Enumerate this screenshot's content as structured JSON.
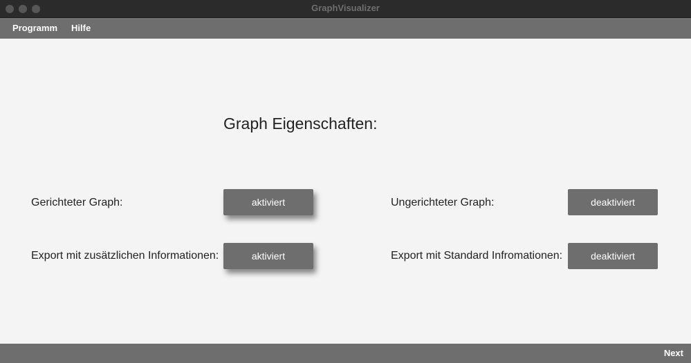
{
  "window": {
    "title": "GraphVisualizer"
  },
  "menubar": {
    "items": [
      {
        "label": "Programm"
      },
      {
        "label": "Hilfe"
      }
    ]
  },
  "main": {
    "heading": "Graph Eigenschaften:",
    "options": {
      "directed": {
        "label": "Gerichteter Graph:",
        "button": "aktiviert",
        "state": "active"
      },
      "undirected": {
        "label": "Ungerichteter Graph:",
        "button": "deaktiviert",
        "state": "inactive"
      },
      "export_extra": {
        "label": "Export mit zusätzlichen Informationen:",
        "button": "aktiviert",
        "state": "active"
      },
      "export_standard": {
        "label": "Export mit Standard Infromationen:",
        "button": "deaktiviert",
        "state": "inactive"
      }
    }
  },
  "footer": {
    "next_label": "Next"
  },
  "colors": {
    "titlebar": "#2b2b2b",
    "menubar": "#6e6e6e",
    "background": "#f4f4f4",
    "button": "#6e6e6e",
    "button_text": "#ffffff",
    "text": "#222222"
  }
}
